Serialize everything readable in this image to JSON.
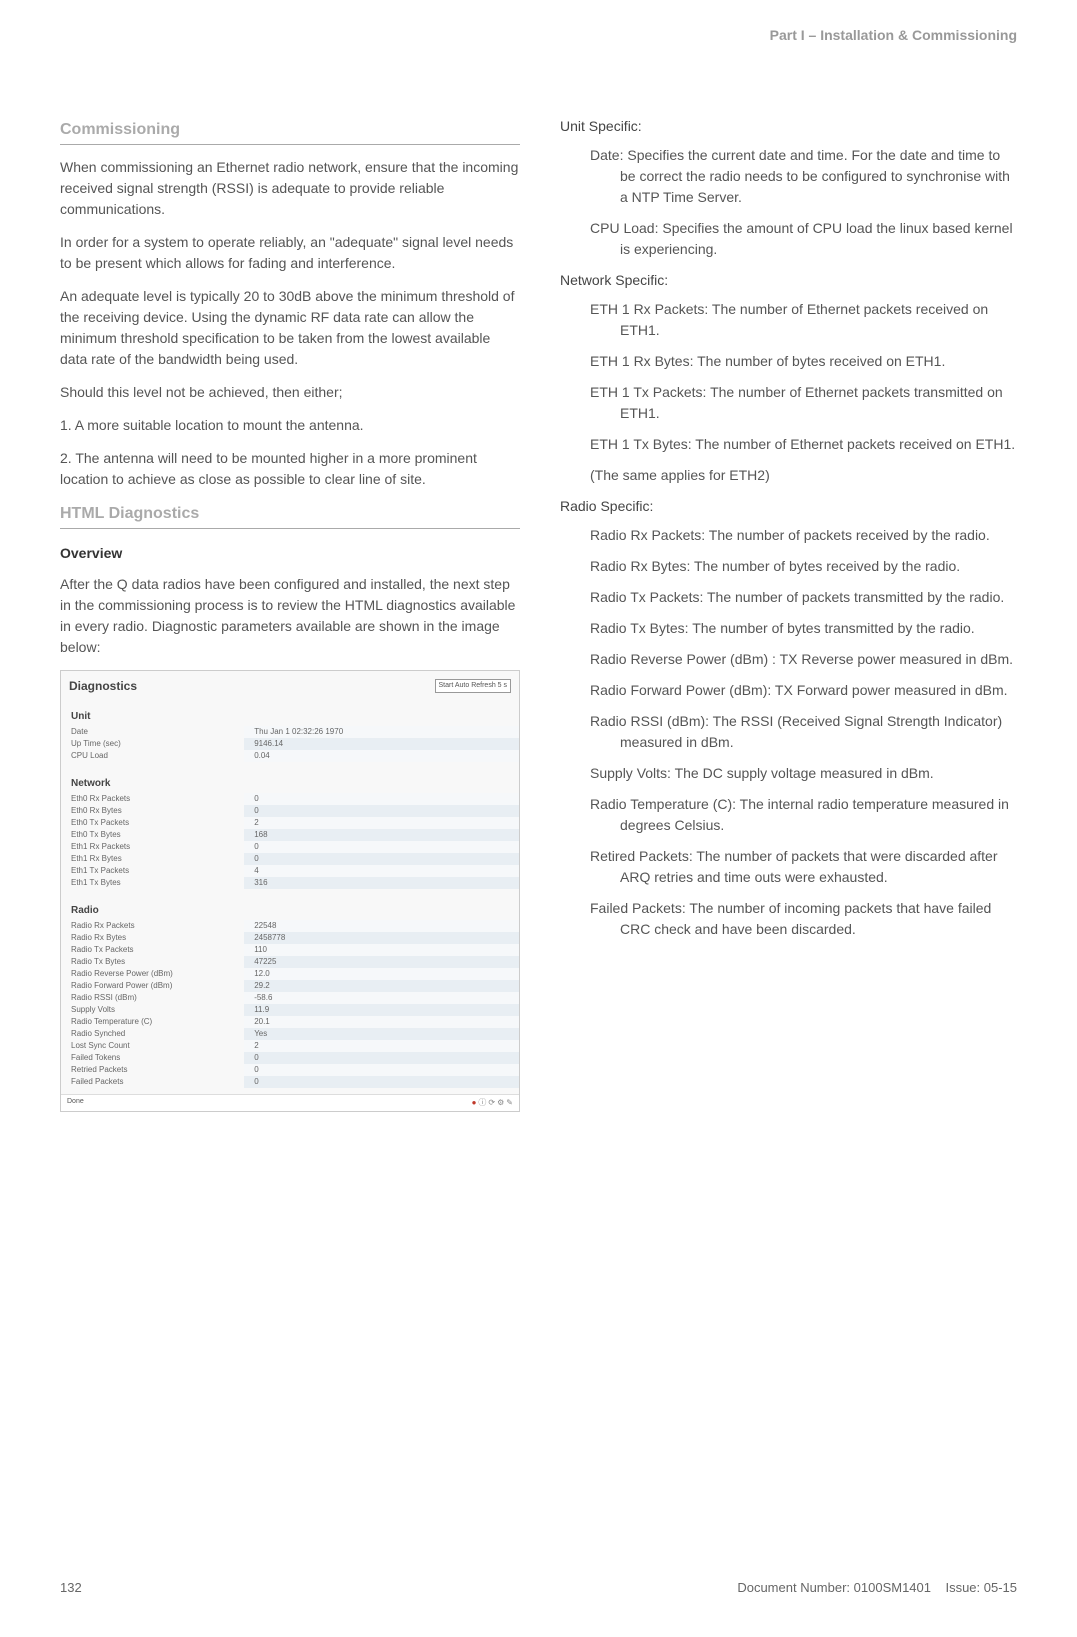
{
  "header": {
    "part_title": "Part I – Installation & Commissioning"
  },
  "left": {
    "commissioning_title": "Commissioning",
    "p1": "When commissioning an Ethernet radio network, ensure that the incoming received signal strength (RSSI) is adequate to provide reliable communications.",
    "p2": "In order for a system to operate reliably, an \"adequate\" signal level needs to be present which allows for fading and interference.",
    "p3": "An adequate level is typically 20 to 30dB above the minimum threshold of the receiving device. Using the dynamic RF data rate can allow the minimum threshold specification to be taken from the lowest available data rate of the bandwidth being used.",
    "p4": "Should this level not be achieved, then either;",
    "p5": "1. A more suitable location to mount the antenna.",
    "p6": "2. The antenna will need to be mounted higher in a more prominent location to achieve as close as possible to clear line of site.",
    "html_diag_title": "HTML Diagnostics",
    "overview_title": "Overview",
    "overview_text": "After the Q data radios have been configured and installed, the next step in the commissioning process is to review the HTML diagnostics available in every radio. Diagnostic parameters available are shown in the image below:"
  },
  "diag": {
    "title": "Diagnostics",
    "refresh_label": "Start Auto Refresh 5 s",
    "unit_title": "Unit",
    "unit_rows": [
      {
        "label": "Date",
        "value": "Thu Jan 1 02:32:26 1970"
      },
      {
        "label": "Up Time (sec)",
        "value": "9146.14"
      },
      {
        "label": "CPU Load",
        "value": "0.04"
      }
    ],
    "network_title": "Network",
    "network_rows": [
      {
        "label": "Eth0 Rx Packets",
        "value": "0"
      },
      {
        "label": "Eth0 Rx Bytes",
        "value": "0"
      },
      {
        "label": "Eth0 Tx Packets",
        "value": "2"
      },
      {
        "label": "Eth0 Tx Bytes",
        "value": "168"
      },
      {
        "label": "Eth1 Rx Packets",
        "value": "0"
      },
      {
        "label": "Eth1 Rx Bytes",
        "value": "0"
      },
      {
        "label": "Eth1 Tx Packets",
        "value": "4"
      },
      {
        "label": "Eth1 Tx Bytes",
        "value": "316"
      }
    ],
    "radio_title": "Radio",
    "radio_rows": [
      {
        "label": "Radio Rx Packets",
        "value": "22548"
      },
      {
        "label": "Radio Rx Bytes",
        "value": "2458778"
      },
      {
        "label": "Radio Tx Packets",
        "value": "110"
      },
      {
        "label": "Radio Tx Bytes",
        "value": "47225"
      },
      {
        "label": "Radio Reverse Power (dBm)",
        "value": "12.0"
      },
      {
        "label": "Radio Forward Power (dBm)",
        "value": "29.2"
      },
      {
        "label": "Radio RSSI (dBm)",
        "value": "-58.6"
      },
      {
        "label": "Supply Volts",
        "value": "11.9"
      },
      {
        "label": "Radio Temperature (C)",
        "value": "20.1"
      },
      {
        "label": "Radio Synched",
        "value": "Yes"
      },
      {
        "label": "Lost Sync Count",
        "value": "2"
      },
      {
        "label": "Failed Tokens",
        "value": "0"
      },
      {
        "label": "Retried Packets",
        "value": "0"
      },
      {
        "label": "Failed Packets",
        "value": "0"
      }
    ],
    "footer_left": "Done"
  },
  "right": {
    "unit_specific": "Unit Specific:",
    "date_item": "Date: Specifies the current date and time. For the date and time to be correct the radio needs to be configured to synchronise with a NTP Time Server.",
    "cpu_item": "CPU Load: Specifies the amount of CPU load the linux based kernel is experiencing.",
    "network_specific": "Network Specific:",
    "eth1_rx_packets": "ETH 1 Rx Packets: The number of Ethernet packets received on ETH1.",
    "eth1_rx_bytes": "ETH 1 Rx Bytes: The number of bytes received on ETH1.",
    "eth1_tx_packets": "ETH 1 Tx Packets: The number of Ethernet packets transmitted on ETH1.",
    "eth1_tx_bytes": "ETH 1 Tx Bytes: The number of Ethernet packets received on ETH1.",
    "eth2_note": "(The same applies for ETH2)",
    "radio_specific": "Radio Specific:",
    "radio_rx_packets": "Radio Rx Packets: The number of packets received by the radio.",
    "radio_rx_bytes": "Radio Rx Bytes: The number of bytes received by the radio.",
    "radio_tx_packets": "Radio Tx Packets: The number of packets transmitted by the radio.",
    "radio_tx_bytes": "Radio Tx Bytes: The number of bytes transmitted by the radio.",
    "radio_reverse": "Radio Reverse Power (dBm) : TX Reverse power measured in dBm.",
    "radio_forward": "Radio Forward Power (dBm): TX Forward power measured in dBm.",
    "radio_rssi": "Radio RSSI (dBm): The RSSI (Received Signal Strength Indicator) measured in dBm.",
    "supply_volts": "Supply Volts: The DC supply voltage measured in dBm.",
    "radio_temp": "Radio Temperature (C): The internal radio temperature measured in degrees Celsius.",
    "retired_packets": "Retired Packets: The number of packets that were discarded after ARQ retries and time outs were exhausted.",
    "failed_packets": "Failed Packets: The number of incoming packets that have failed CRC check and have been discarded."
  },
  "footer": {
    "page_number": "132",
    "doc_number": "Document Number: 0100SM1401",
    "issue": "Issue: 05-15"
  }
}
